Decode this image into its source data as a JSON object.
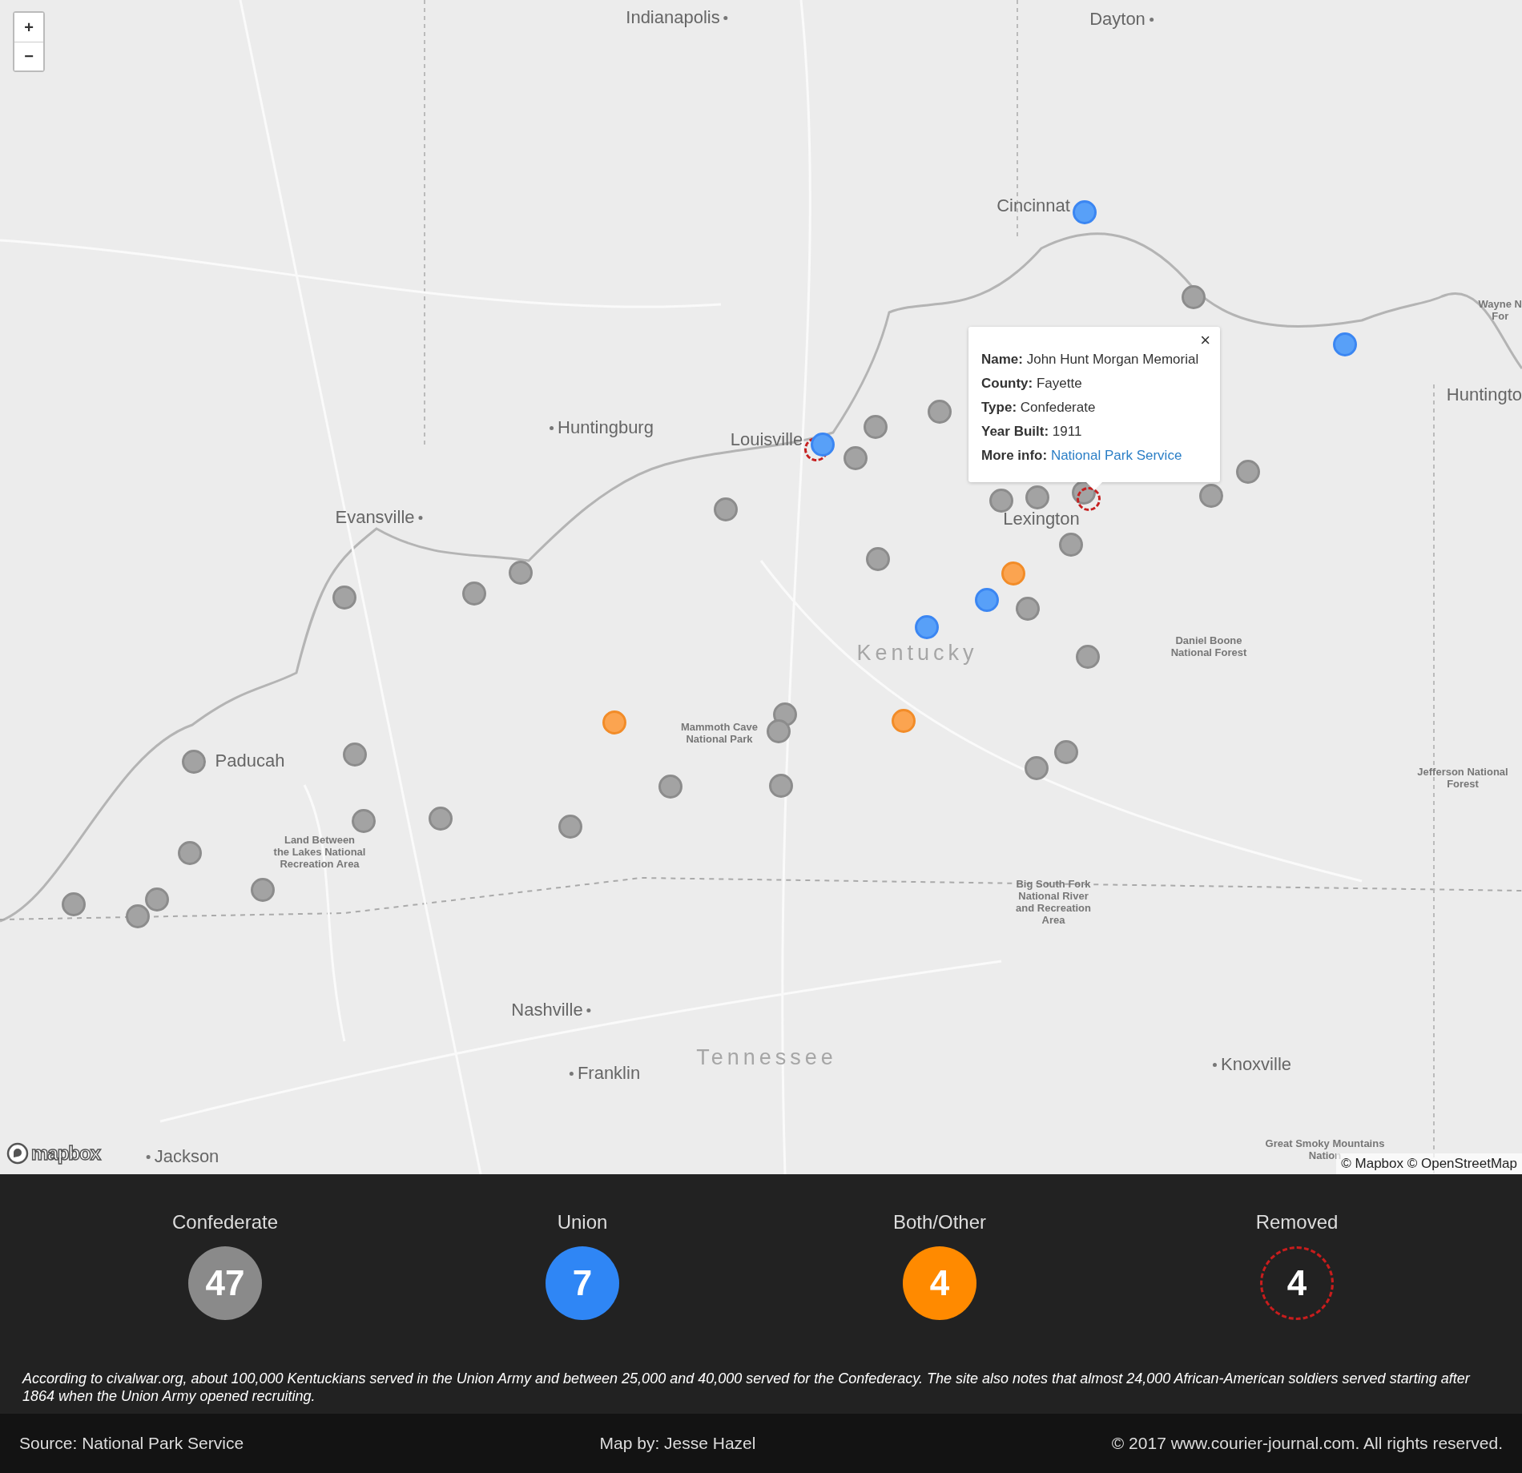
{
  "map": {
    "zoom_controls": [
      "+",
      "−"
    ],
    "place_labels": [
      {
        "text": "Indianapolis",
        "kind": "city"
      },
      {
        "text": "Dayton",
        "kind": "city"
      },
      {
        "text": "Cincinnat",
        "kind": "city"
      },
      {
        "text": "Wayne N\nFor",
        "kind": "park"
      },
      {
        "text": "Huntingto",
        "kind": "city"
      },
      {
        "text": "Huntingburg",
        "kind": "city"
      },
      {
        "text": "Louisville",
        "kind": "city"
      },
      {
        "text": "Evansville",
        "kind": "city"
      },
      {
        "text": "Lexington",
        "kind": "city"
      },
      {
        "text": "Kentucky",
        "kind": "region"
      },
      {
        "text": "Daniel Boone\nNational Forest",
        "kind": "park"
      },
      {
        "text": "Mammoth Cave\nNational Park",
        "kind": "park"
      },
      {
        "text": "Paducah",
        "kind": "city"
      },
      {
        "text": "Land Between\nthe Lakes National\nRecreation Area",
        "kind": "park"
      },
      {
        "text": "Jefferson National\nForest",
        "kind": "park"
      },
      {
        "text": "Big South Fork\nNational River\nand Recreation\nArea",
        "kind": "park"
      },
      {
        "text": "Nashville",
        "kind": "city"
      },
      {
        "text": "Franklin",
        "kind": "city"
      },
      {
        "text": "Tennessee",
        "kind": "region"
      },
      {
        "text": "Knoxville",
        "kind": "city"
      },
      {
        "text": "Jackson",
        "kind": "city"
      },
      {
        "text": "Great Smoky Mountains\nNation",
        "kind": "park"
      }
    ],
    "markers": [
      {
        "kind": "union"
      },
      {
        "kind": "confederate"
      },
      {
        "kind": "union"
      },
      {
        "kind": "confederate"
      },
      {
        "kind": "confederate"
      },
      {
        "kind": "removed"
      },
      {
        "kind": "union"
      },
      {
        "kind": "confederate"
      },
      {
        "kind": "confederate"
      },
      {
        "kind": "confederate"
      },
      {
        "kind": "confederate"
      },
      {
        "kind": "confederate"
      },
      {
        "kind": "confederate"
      },
      {
        "kind": "removed"
      },
      {
        "kind": "confederate"
      },
      {
        "kind": "confederate"
      },
      {
        "kind": "confederate"
      },
      {
        "kind": "confederate"
      },
      {
        "kind": "confederate"
      },
      {
        "kind": "confederate"
      },
      {
        "kind": "other"
      },
      {
        "kind": "union"
      },
      {
        "kind": "confederate"
      },
      {
        "kind": "union"
      },
      {
        "kind": "confederate"
      },
      {
        "kind": "other"
      },
      {
        "kind": "other"
      },
      {
        "kind": "confederate"
      },
      {
        "kind": "confederate"
      },
      {
        "kind": "confederate"
      },
      {
        "kind": "confederate"
      },
      {
        "kind": "confederate"
      },
      {
        "kind": "confederate"
      },
      {
        "kind": "confederate"
      },
      {
        "kind": "confederate"
      },
      {
        "kind": "confederate"
      },
      {
        "kind": "confederate"
      },
      {
        "kind": "confederate"
      },
      {
        "kind": "confederate"
      },
      {
        "kind": "confederate"
      },
      {
        "kind": "confederate"
      },
      {
        "kind": "confederate"
      },
      {
        "kind": "confederate"
      }
    ],
    "popup": {
      "close": "×",
      "fields": [
        {
          "label": "Name:",
          "value": "John Hunt Morgan Memorial"
        },
        {
          "label": "County:",
          "value": "Fayette"
        },
        {
          "label": "Type:",
          "value": "Confederate"
        },
        {
          "label": "Year Built:",
          "value": "1911"
        },
        {
          "label": "More info:",
          "link": "National Park Service"
        }
      ]
    },
    "logo": "mapbox",
    "attribution": "© Mapbox © OpenStreetMap"
  },
  "legend": [
    {
      "label": "Confederate",
      "count": "47",
      "kind": "confederate"
    },
    {
      "label": "Union",
      "count": "7",
      "kind": "union"
    },
    {
      "label": "Both/Other",
      "count": "4",
      "kind": "other"
    },
    {
      "label": "Removed",
      "count": "4",
      "kind": "removed"
    }
  ],
  "note": "According to civalwar.org, about 100,000 Kentuckians served in the Union Army and between 25,000 and 40,000 served for the Confederacy. The site also notes that almost 24,000 African-American soldiers served starting after 1864 when the Union Army opened recruiting.",
  "footer": {
    "source": "Source: National Park Service",
    "credit": "Map by: Jesse Hazel",
    "copyright": "© 2017 www.courier-journal.com. All rights reserved."
  }
}
